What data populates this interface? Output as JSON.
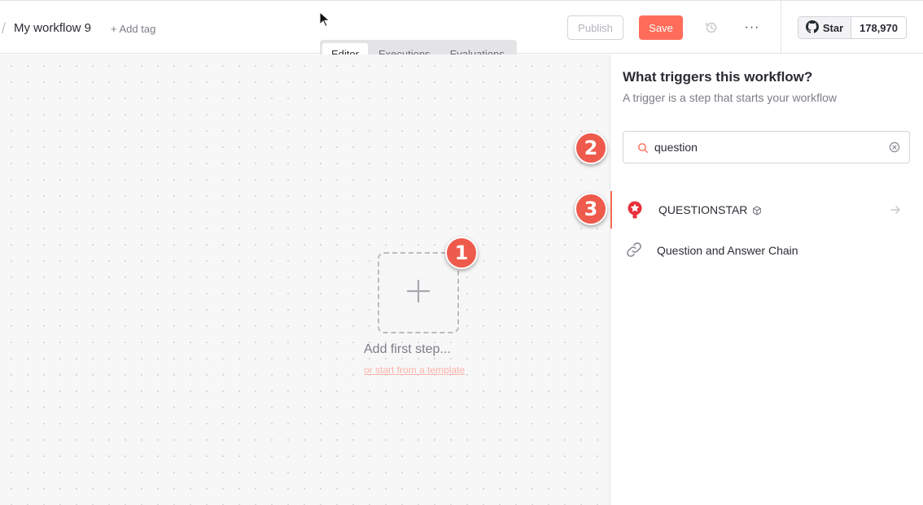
{
  "header": {
    "breadcrumb_sep": "/",
    "workflow_name": "My workflow 9",
    "add_tag": "+ Add tag",
    "publish_label": "Publish",
    "save_label": "Save",
    "more_label": "···",
    "github_star_label": "Star",
    "github_star_count": "178,970"
  },
  "tabs": [
    {
      "label": "Editor",
      "active": true
    },
    {
      "label": "Executions",
      "active": false
    },
    {
      "label": "Evaluations",
      "active": false
    }
  ],
  "canvas": {
    "add_first_step": "Add first step...",
    "template_link": "or start from a template"
  },
  "panel": {
    "title": "What triggers this workflow?",
    "subtitle": "A trigger is a step that starts your workflow",
    "search_value": "question",
    "results": [
      {
        "label": "QUESTIONSTAR",
        "icon": "questionstar-icon",
        "community_node": true,
        "selected": true
      },
      {
        "label": "Question and Answer Chain",
        "icon": "link-icon",
        "community_node": false,
        "selected": false
      }
    ]
  },
  "badges": [
    "1",
    "2",
    "3"
  ],
  "colors": {
    "accent": "#ff6d5a",
    "badge": "#ee5a4b",
    "tab_bg": "#e4e4e7"
  }
}
